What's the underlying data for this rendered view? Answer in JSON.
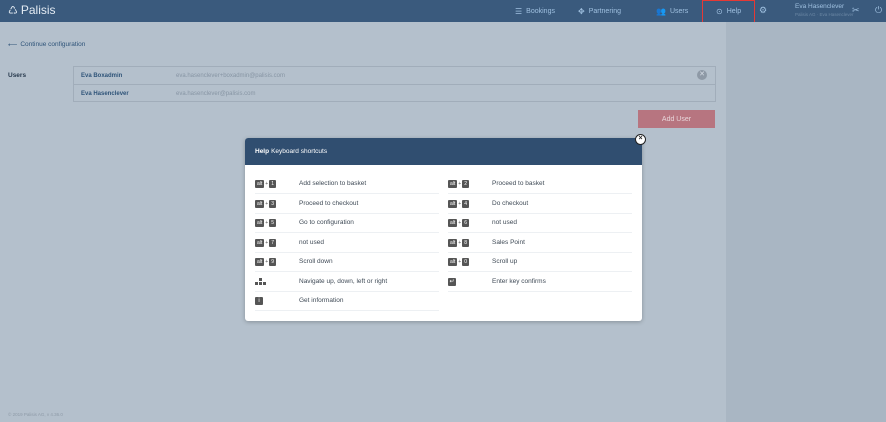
{
  "app": {
    "logo": "Palisis",
    "logo_icon": "palisis-logo-icon"
  },
  "nav": {
    "bookings": "Bookings",
    "partnering": "Partnering",
    "users": "Users",
    "help": "Help"
  },
  "user": {
    "name": "Eva Hasenclever",
    "subtitle": "Palisis AG · Eva Hasenclever"
  },
  "back_link": "Continue configuration",
  "users_label": "Users",
  "users": [
    {
      "name": "Eva Boxadmin",
      "email": "eva.hasenclever+boxadmin@palisis.com"
    },
    {
      "name": "Eva Hasenclever",
      "email": "eva.hasenclever@palisis.com"
    }
  ],
  "add_user": "Add User",
  "footer": "© 2019 Palisis AG, v 4.36.0",
  "modal": {
    "title": "Help",
    "subtitle": "Keyboard shortcuts",
    "alt": "alt",
    "plus": "+",
    "shortcuts": [
      {
        "key": "1",
        "label": "Add selection to basket"
      },
      {
        "key": "2",
        "label": "Proceed to basket"
      },
      {
        "key": "3",
        "label": "Proceed to checkout"
      },
      {
        "key": "4",
        "label": "Do checkout"
      },
      {
        "key": "5",
        "label": "Go to configuration"
      },
      {
        "key": "6",
        "label": "not used"
      },
      {
        "key": "7",
        "label": "not used"
      },
      {
        "key": "8",
        "label": "Sales Point"
      },
      {
        "key": "9",
        "label": "Scroll down"
      },
      {
        "key": "0",
        "label": "Scroll up"
      }
    ],
    "extra": {
      "nav": "Navigate up, down, left or right",
      "enter": "Enter key confirms",
      "info": "Get information"
    }
  },
  "colors": {
    "topbar": "#3a5a7d",
    "accent": "#2f5479",
    "add_button": "#b77580",
    "highlight": "#e53935"
  }
}
